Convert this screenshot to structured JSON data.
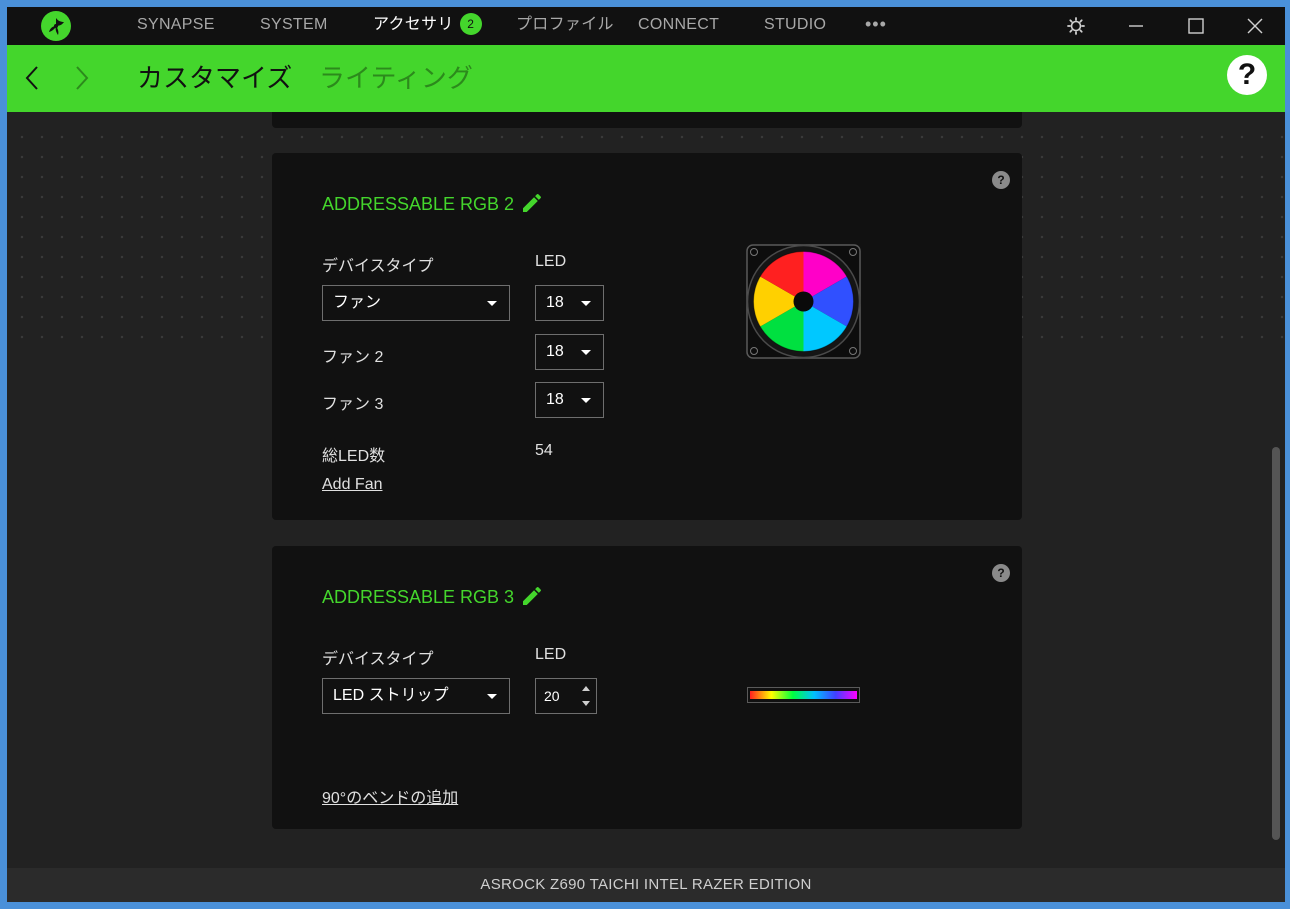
{
  "nav": {
    "items": [
      {
        "label": "SYNAPSE"
      },
      {
        "label": "SYSTEM"
      },
      {
        "label": "アクセサリ",
        "badge": "2"
      },
      {
        "label": "プロファイル"
      },
      {
        "label": "CONNECT"
      },
      {
        "label": "STUDIO"
      }
    ],
    "more": "•••"
  },
  "subnav": {
    "tabs": [
      {
        "label": "カスタマイズ"
      },
      {
        "label": "ライティング"
      }
    ],
    "help": "?"
  },
  "cards": [
    {
      "title": "ADDRESSABLE RGB 2",
      "device_type_label": "デバイスタイプ",
      "led_label": "LED",
      "device_type_value": "ファン",
      "led_value": "18",
      "fans": [
        {
          "label": "ファン 2",
          "led": "18"
        },
        {
          "label": "ファン 3",
          "led": "18"
        }
      ],
      "total_label": "総LED数",
      "total_value": "54",
      "add_link": "Add Fan",
      "help": "?"
    },
    {
      "title": "ADDRESSABLE RGB 3",
      "device_type_label": "デバイスタイプ",
      "led_label": "LED",
      "device_type_value": "LED ストリップ",
      "led_value": "20",
      "add_link": "90°のベンドの追加",
      "help": "?"
    }
  ],
  "footer": {
    "device": "ASROCK Z690 TAICHI INTEL RAZER EDITION"
  },
  "colors": {
    "accent": "#44d62c",
    "card_bg": "#111111",
    "page_bg": "#222222"
  }
}
